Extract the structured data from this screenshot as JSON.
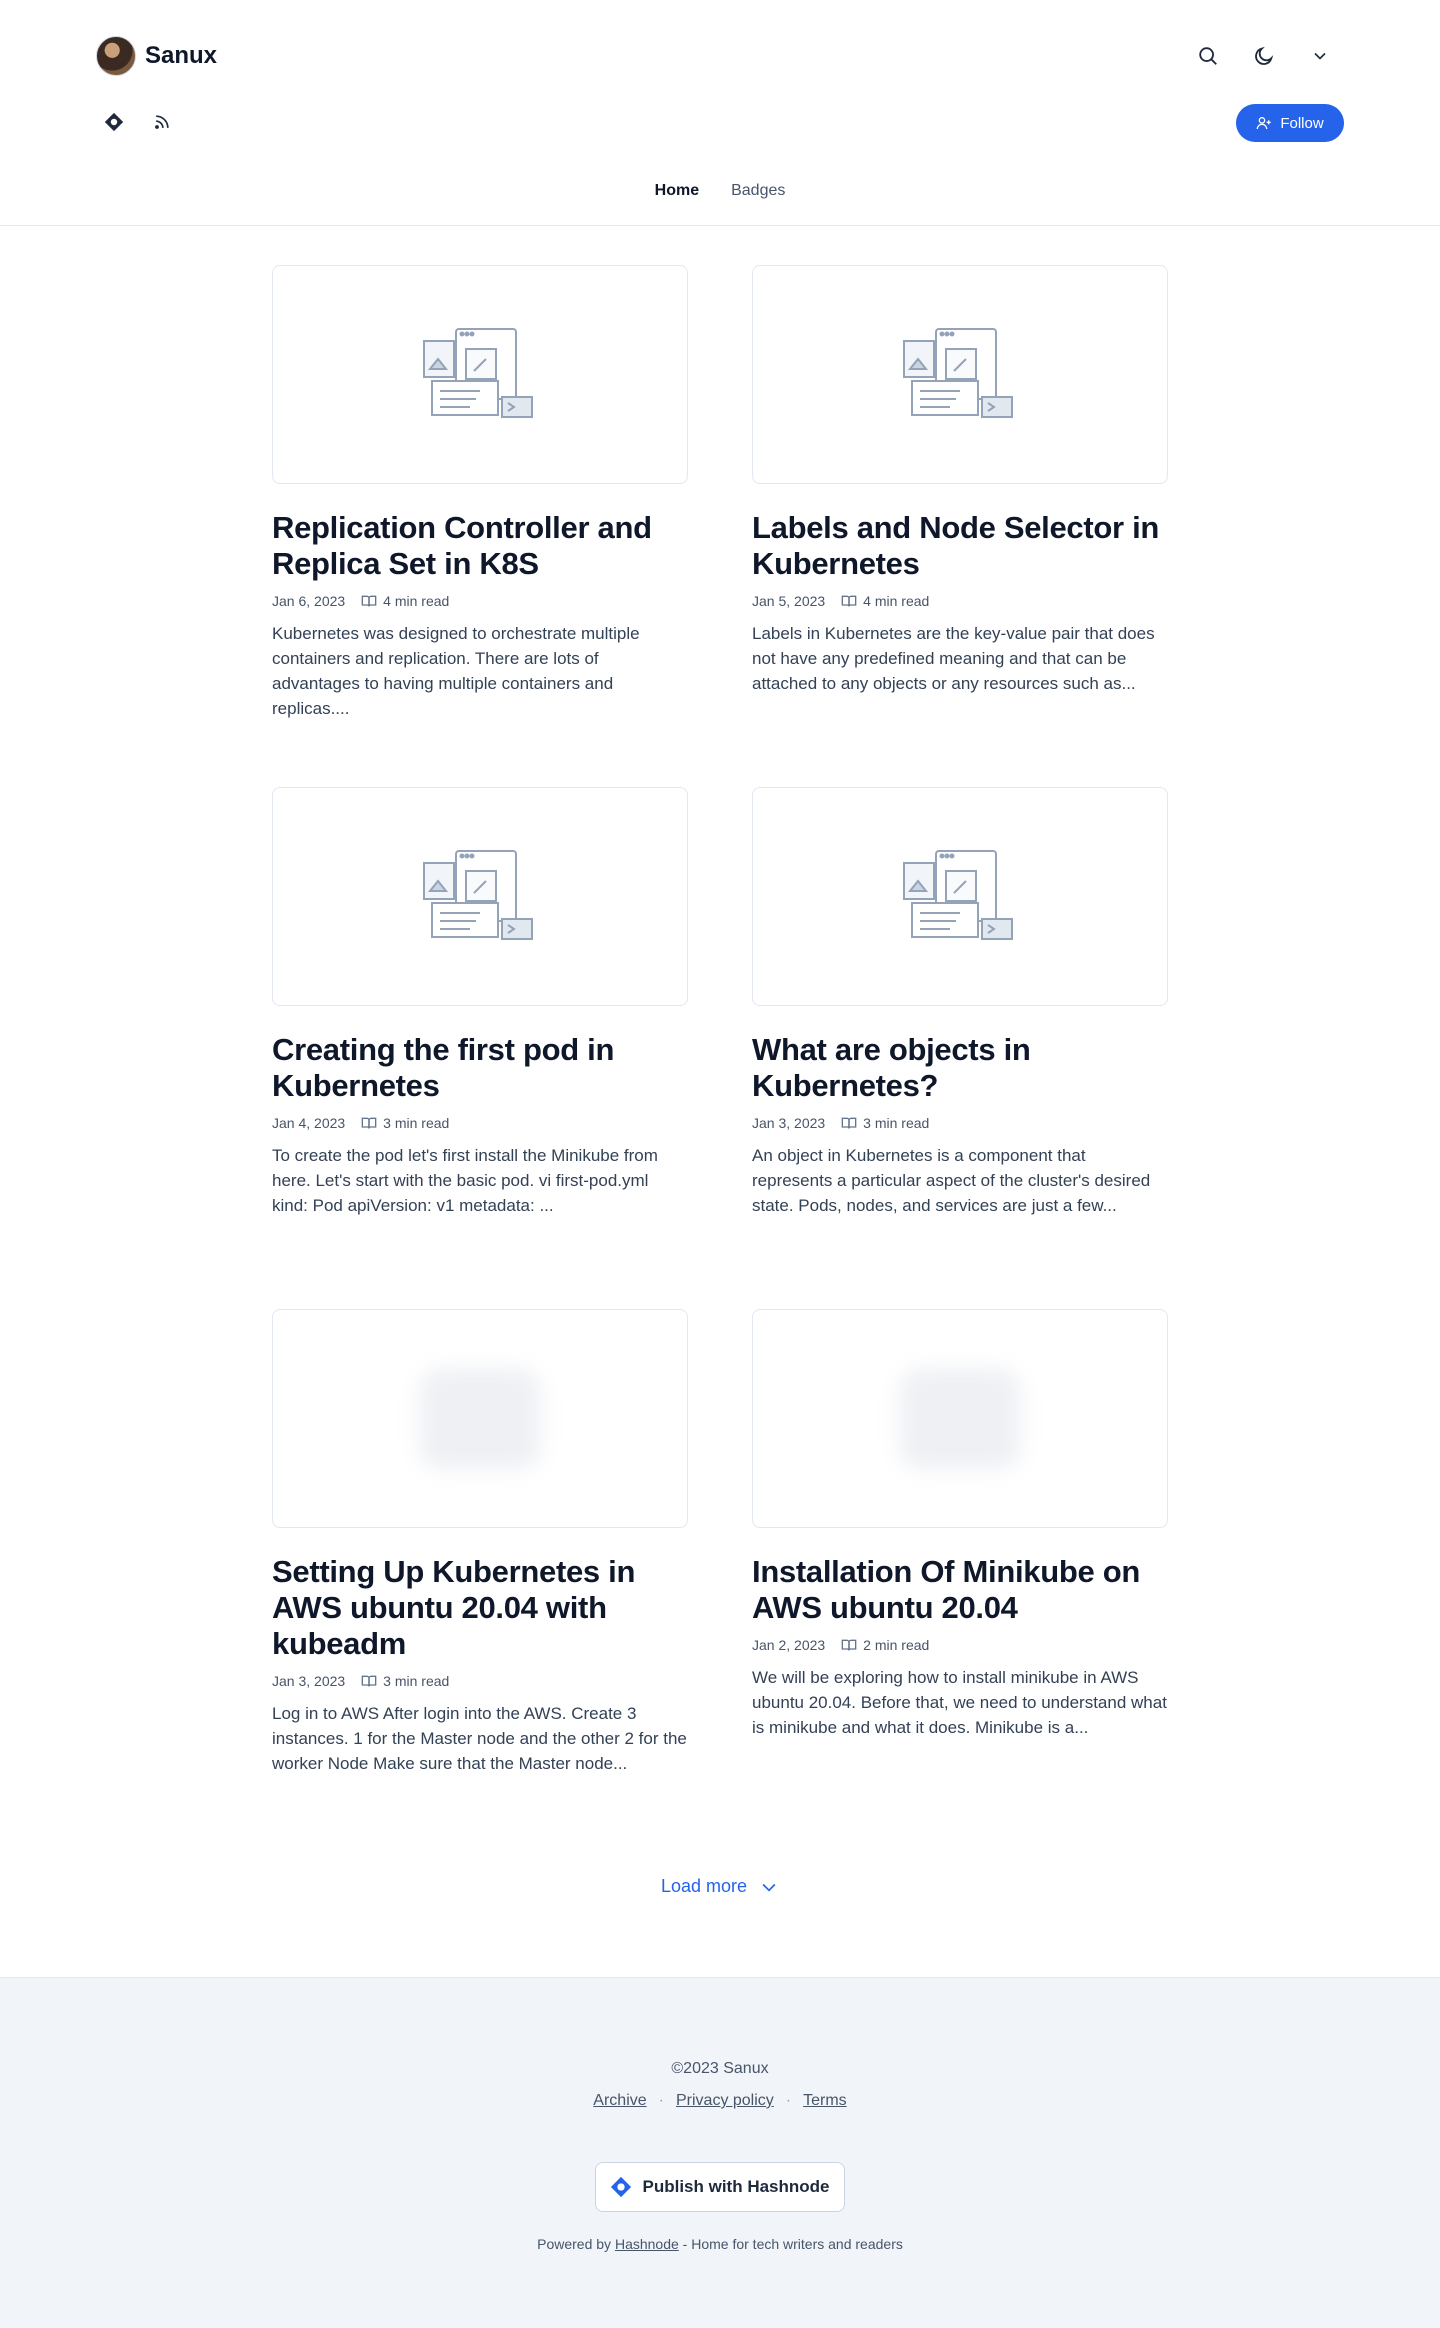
{
  "header": {
    "blog_name": "Sanux",
    "follow_label": "Follow",
    "icons": [
      "search-icon",
      "moon-icon",
      "chevron-down-icon"
    ],
    "social_icons": [
      "hashnode-icon",
      "rss-icon"
    ]
  },
  "nav": {
    "items": [
      {
        "label": "Home",
        "active": true
      },
      {
        "label": "Badges",
        "active": false
      }
    ]
  },
  "posts": [
    {
      "title": "Replication Controller and Replica Set in K8S",
      "date": "Jan 6, 2023",
      "read_time": "4 min read",
      "excerpt": "Kubernetes was designed to orchestrate multiple containers and replication. There are lots of advantages to having multiple containers and replicas...."
    },
    {
      "title": "Labels and Node Selector in Kubernetes",
      "date": "Jan 5, 2023",
      "read_time": "4 min read",
      "excerpt": "Labels in Kubernetes are the key-value pair that does not have any predefined meaning and that can be attached to any objects or any resources such as..."
    },
    {
      "title": "Creating the first pod in Kubernetes",
      "date": "Jan 4, 2023",
      "read_time": "3 min read",
      "excerpt": "To create the pod let's first install the Minikube from here. Let's start with the basic pod. vi first-pod.yml kind: Pod apiVersion: v1 metadata: ..."
    },
    {
      "title": "What are objects in Kubernetes?",
      "date": "Jan 3, 2023",
      "read_time": "3 min read",
      "excerpt": "An object in Kubernetes is a component that represents a particular aspect of the cluster's desired state. Pods, nodes, and services are just a few..."
    },
    {
      "title": "Setting Up Kubernetes in AWS ubuntu 20.04 with kubeadm",
      "date": "Jan 3, 2023",
      "read_time": "3 min read",
      "excerpt": "Log in to AWS After login into the AWS. Create 3 instances. 1 for the Master node and the other 2 for the worker Node Make sure that the Master node..."
    },
    {
      "title": "Installation Of Minikube on AWS ubuntu 20.04",
      "date": "Jan 2, 2023",
      "read_time": "2 min read",
      "excerpt": "We will be exploring how to install minikube in AWS ubuntu 20.04. Before that, we need to understand what is minikube and what it does. Minikube is a..."
    }
  ],
  "load_more_label": "Load more",
  "footer": {
    "copyright": "©2023 Sanux",
    "links": [
      "Archive",
      "Privacy policy",
      "Terms"
    ],
    "publish_label": "Publish with Hashnode",
    "powered_prefix": "Powered by",
    "powered_link": "Hashnode",
    "powered_suffix": "- Home for tech writers and readers"
  },
  "colors": {
    "accent": "#2563eb",
    "text": "#0f172a",
    "muted": "#475569",
    "footer_bg": "#f1f5f9"
  }
}
